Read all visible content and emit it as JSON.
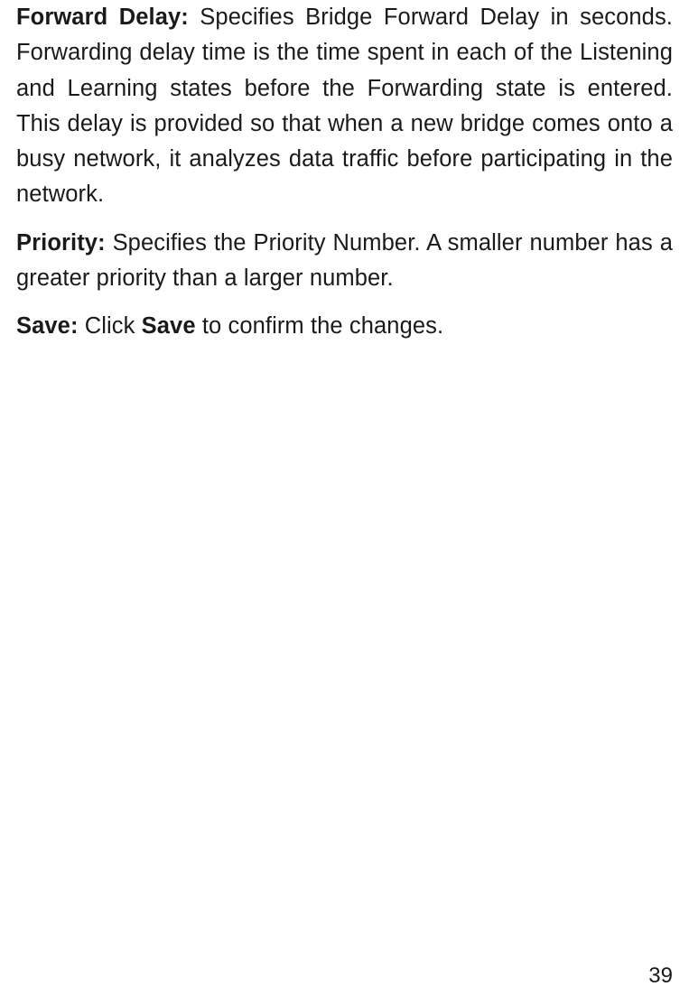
{
  "paragraphs": {
    "forward_delay": {
      "label": "Forward Delay:",
      "text": " Specifies Bridge Forward Delay in seconds. Forwarding delay time is the time spent in each of the Listening and Learning states before the Forwarding state is entered. This delay is provided so that when a new bridge comes onto a busy network, it analyzes data traffic before participating in the network."
    },
    "priority": {
      "label": "Priority:",
      "text": " Specifies the Priority Number. A smaller number has a greater priority than a larger number."
    },
    "save": {
      "label": "Save:",
      "text_before": " Click ",
      "bold_inline": "Save",
      "text_after": " to confirm the changes."
    }
  },
  "page_number": "39"
}
